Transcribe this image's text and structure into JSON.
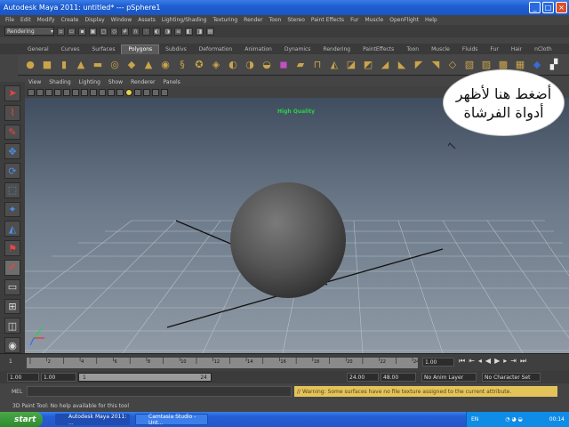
{
  "window": {
    "title": "Autodesk Maya 2011: untitled*   ---   pSphere1"
  },
  "menu": [
    "File",
    "Edit",
    "Modify",
    "Create",
    "Display",
    "Window",
    "Assets",
    "Lighting/Shading",
    "Texturing",
    "Render",
    "Toon",
    "Stereo",
    "Paint Effects",
    "Fur",
    "Muscle",
    "OpenFlight",
    "Help"
  ],
  "statusline": {
    "mode": "Rendering"
  },
  "shelf_tabs": [
    "General",
    "Curves",
    "Surfaces",
    "Polygons",
    "Subdivs",
    "Deformation",
    "Animation",
    "Dynamics",
    "Rendering",
    "PaintEffects",
    "Toon",
    "Muscle",
    "Fluids",
    "Fur",
    "Hair",
    "nCloth"
  ],
  "shelf_active": "Polygons",
  "panel_menu": [
    "View",
    "Shading",
    "Lighting",
    "Show",
    "Renderer",
    "Panels"
  ],
  "viewport": {
    "hud": "High Quality"
  },
  "callout": {
    "line1": "أضغط هنا لأظهر",
    "line2": "أدواة الفرشاة"
  },
  "timeline": {
    "ticks": [
      "2",
      "4",
      "6",
      "8",
      "10",
      "12",
      "14",
      "16",
      "18",
      "20",
      "22",
      "24"
    ],
    "current": "1.00"
  },
  "range": {
    "start": "1.00",
    "inner_start": "1.00",
    "slider_start": "1",
    "slider_end": "24",
    "end": "24.00",
    "outer_end": "48.00",
    "anim_layer": "No Anim Layer",
    "character": "No Character Set"
  },
  "mel": {
    "label": "MEL",
    "warning": "// Warning: Some surfaces have no file texture assigned to the current attribute."
  },
  "help": "3D Paint Tool: No help available for this tool",
  "taskbar": {
    "start": "start",
    "tasks": [
      "Autodesk Maya 2011: ...",
      "Camtasia Studio - Unt..."
    ],
    "lang": "EN",
    "time": "00:14"
  }
}
